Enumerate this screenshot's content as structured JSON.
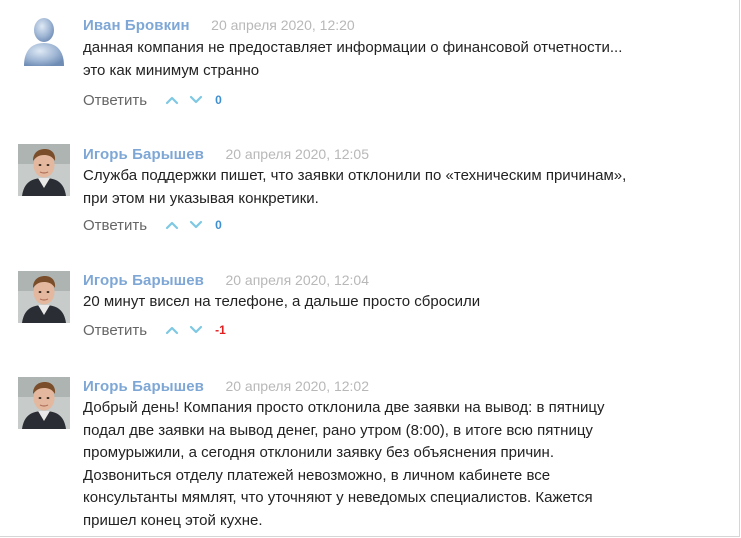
{
  "theme": {
    "author_color": "#7ea7d6",
    "date_color": "#b8b8b8",
    "text_color": "#222222",
    "reply_color": "#666666",
    "vote_arrow_color": "#7ec8e3",
    "score_zero_color": "#3d8fd1",
    "score_negative_color": "#e02020"
  },
  "comments": [
    {
      "author": "Иван Бровкин",
      "date": "20 апреля 2020, 12:20",
      "avatar": "default-user-silhouette",
      "lines": [
        "данная компания не предоставляет информации о финансовой отчетности...",
        "это как минимум странно"
      ],
      "reply_label": "Ответить",
      "score": "0"
    },
    {
      "author": "Игорь Барышев",
      "date": "20 апреля 2020, 12:05",
      "avatar": "user-photo",
      "lines": [
        "Служба поддержки пишет, что заявки отклонили по «техническим причинам»,",
        "при этом ни указывая конкретики."
      ],
      "reply_label": "Ответить",
      "score": "0"
    },
    {
      "author": "Игорь Барышев",
      "date": "20 апреля 2020, 12:04",
      "avatar": "user-photo",
      "lines": [
        "20 минут висел на телефоне, а дальше просто сбросили"
      ],
      "reply_label": "Ответить",
      "score": "-1"
    },
    {
      "author": "Игорь Барышев",
      "date": "20 апреля 2020, 12:02",
      "avatar": "user-photo",
      "lines": [
        "Добрый день! Компания просто отклонила две заявки на вывод: в пятницу",
        "подал две заявки на вывод денег, рано утром (8:00), в итоге всю пятницу",
        "промурыжили, а сегодня отклонили заявку без объяснения причин.",
        "Дозвониться отделу платежей невозможно, в личном кабинете все",
        "консультанты мямлят, что уточняют у неведомых специалистов. Кажется",
        "пришел конец этой кухне."
      ],
      "reply_label": "",
      "score": ""
    }
  ]
}
